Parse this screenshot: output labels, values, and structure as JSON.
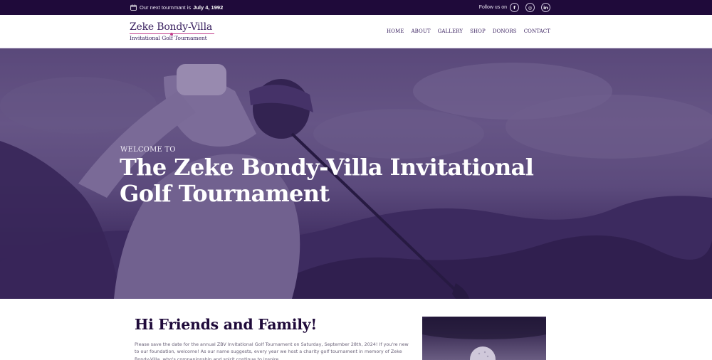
{
  "topbar": {
    "next_label": "Our next tournmant is",
    "next_date": "July 4, 1992",
    "follow_label": "Follow us on",
    "social": [
      {
        "icon": "facebook-icon",
        "glyph": "f"
      },
      {
        "icon": "instagram-icon",
        "glyph": "◎"
      },
      {
        "icon": "linkedin-icon",
        "glyph": "in"
      }
    ]
  },
  "header": {
    "logo_line1": "Zeke Bondy-Villa",
    "logo_line2": "Invitational Golf Tournament",
    "nav": [
      "HOME",
      "ABOUT",
      "GALLERY",
      "SHOP",
      "DONORS",
      "CONTACT"
    ]
  },
  "hero": {
    "kicker": "WELCOME TO",
    "title": "The Zeke Bondy-Villa Invitational Golf Tournament"
  },
  "intro": {
    "heading": "Hi Friends and Family!",
    "body": "Please save the date for the annual ZBV Invitational Golf Tournament on Saturday, September 28th, 2024! If you're new to our foundation, welcome! As our name suggests, every year we host a charity golf tournament in memory of Zeke Bondy-Villa, who's companionship and spirit continue to inspire"
  },
  "colors": {
    "topbar_bg": "#1f0a3a",
    "brand_purple": "#3a2160",
    "accent_pink": "#c23a8a",
    "hero_tint": "#5b4a7e"
  }
}
